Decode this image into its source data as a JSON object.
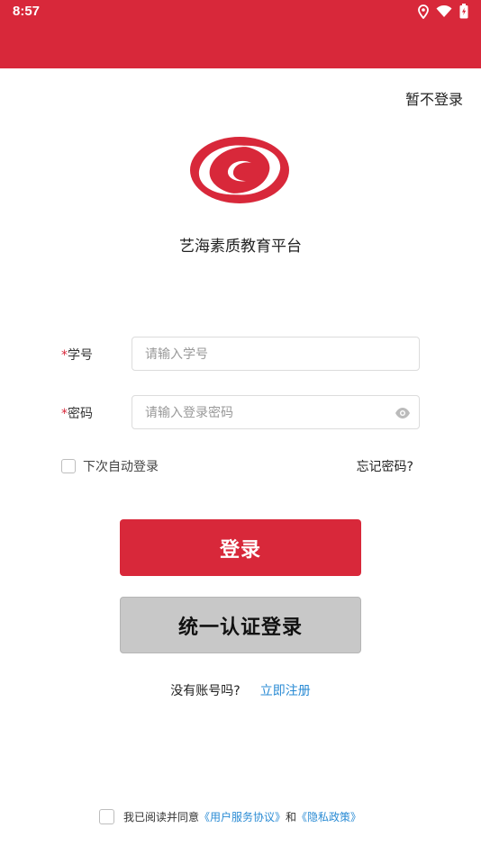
{
  "status_bar": {
    "time": "8:57",
    "icons": [
      "location-icon",
      "wifi-icon",
      "battery-charging-icon"
    ]
  },
  "header": {
    "skip_login": "暂不登录"
  },
  "brand": {
    "app_name": "艺海素质教育平台",
    "accent_color": "#d8283a"
  },
  "form": {
    "required_mark": "*",
    "student_id_label": "学号",
    "student_id_placeholder": "请输入学号",
    "student_id_value": "",
    "password_label": "密码",
    "password_placeholder": "请输入登录密码",
    "password_value": "",
    "auto_login_label": "下次自动登录",
    "auto_login_checked": false,
    "forgot_password": "忘记密码?"
  },
  "actions": {
    "login_label": "登录",
    "unified_login_label": "统一认证登录"
  },
  "register": {
    "question": "没有账号吗?",
    "link": "立即注册"
  },
  "agreement": {
    "checked": false,
    "prefix": "我已阅读并同意",
    "user_agreement": "《用户服务协议》",
    "conjunction": "和",
    "privacy_policy": "《隐私政策》",
    "link_color": "#2a8bd4"
  }
}
